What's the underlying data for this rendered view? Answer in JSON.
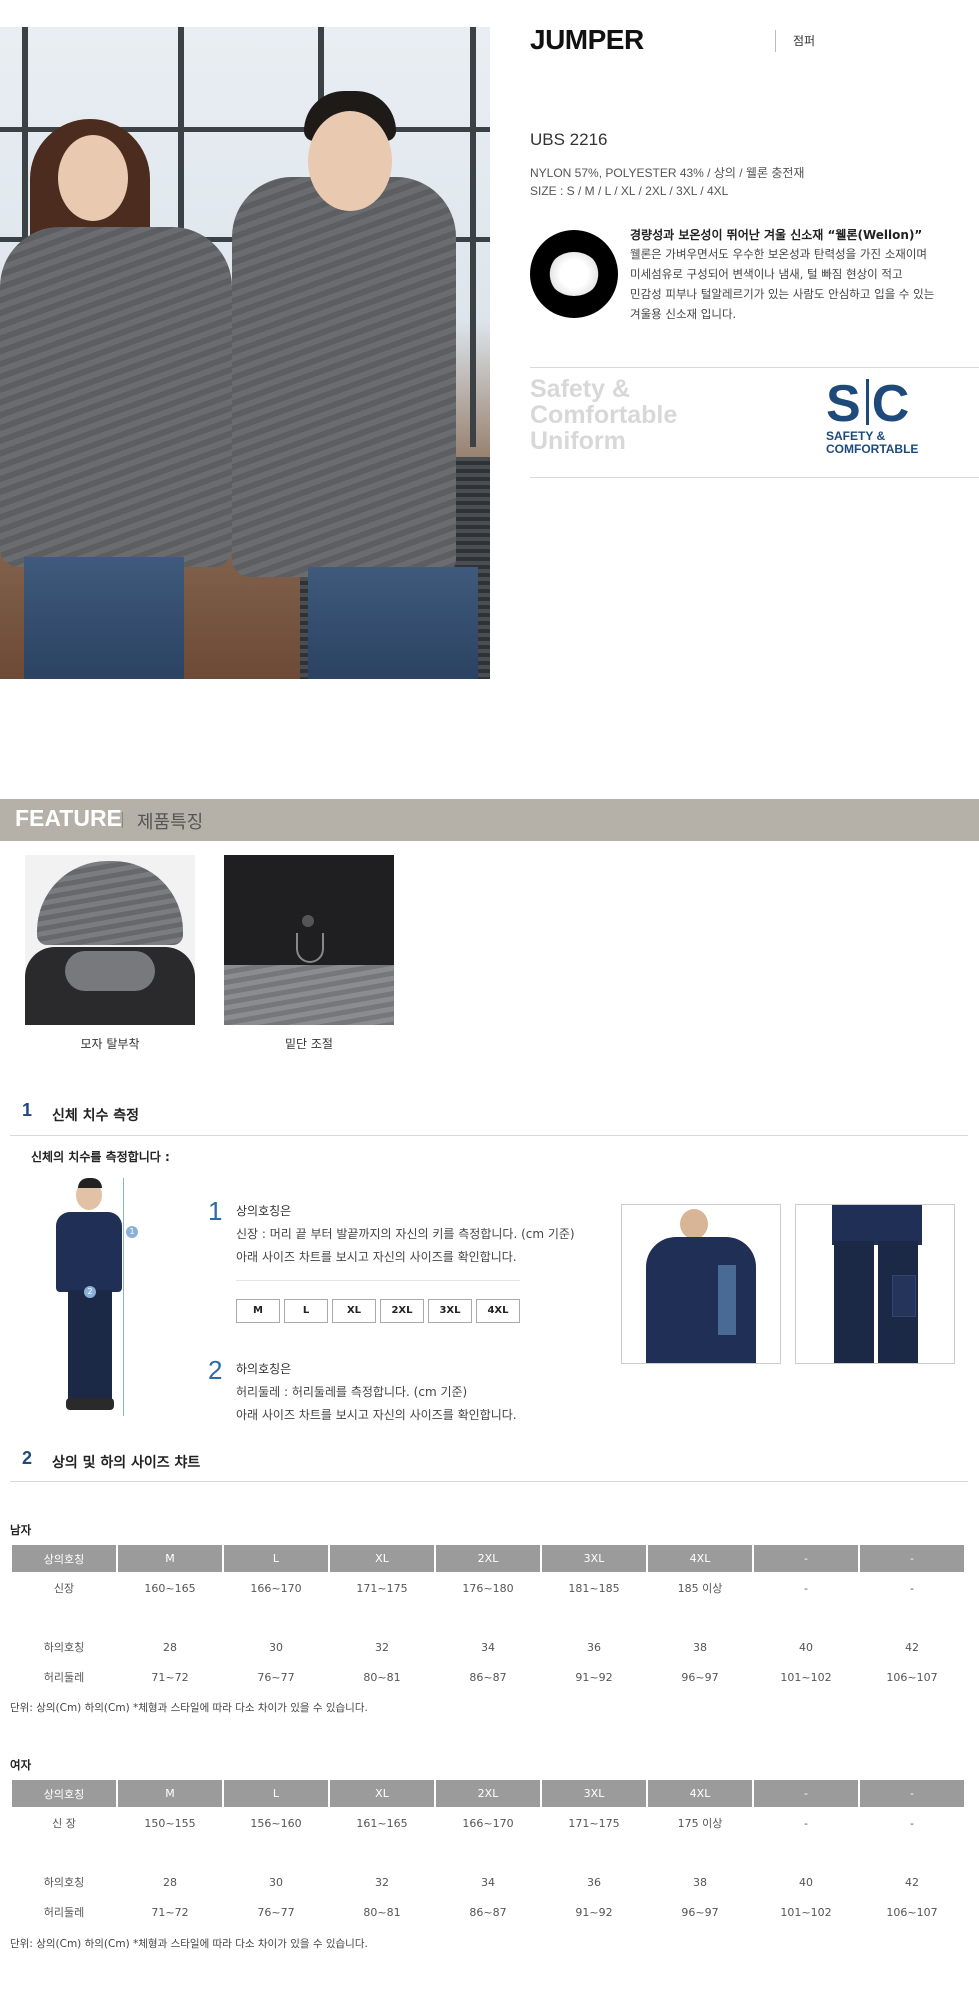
{
  "product": {
    "title": "JUMPER",
    "title_kr": "점퍼",
    "code": "UBS 2216",
    "material": "NYLON 57%, POLYESTER 43% / 상의 / 웰론 충전재",
    "sizes": "SIZE : S / M / L / XL / 2XL / 3XL / 4XL"
  },
  "wellon": {
    "headline": "경량성과 보온성이 뛰어난 겨울 신소재 “웰론(Wellon)”",
    "lines": [
      "웰론은 가벼우면서도 우수한 보온성과 탄력성을 가진 소재이며",
      "미세섬유로 구성되어 변색이나 냄새, 털 빠짐 현상이 적고",
      "민감성 피부나 털알레르기가 있는 사람도 안심하고 입을 수 있는",
      "겨울용 신소재 입니다."
    ]
  },
  "brand": {
    "slogan": [
      "Safety &",
      "Comfortable",
      "Uniform"
    ],
    "logo_left": "S",
    "logo_right": "C",
    "logo_sub": [
      "SAFETY &",
      "COMFORTABLE"
    ],
    "color": "#1d4a7a"
  },
  "feature": {
    "title_en": "FEATURE",
    "title_kr": "제품특징",
    "items": [
      {
        "caption": "모자 탈부착",
        "icon": "hood-photo"
      },
      {
        "caption": "밑단 조절",
        "icon": "hem-photo"
      }
    ]
  },
  "section1": {
    "number": "1",
    "title": "신체 치수 측정",
    "subtitle": "신체의 치수를 측정합니다 :",
    "top": {
      "number": "1",
      "title": "상의호칭은",
      "line1": "신장 : 머리 끝 부터 발끝까지의 자신의 키를 측정합니다. (cm 기준)",
      "line2": "아래 사이즈 차트를 보시고 자신의 사이즈를 확인합니다."
    },
    "size_buttons": [
      "M",
      "L",
      "XL",
      "2XL",
      "3XL",
      "4XL"
    ],
    "bottom": {
      "number": "2",
      "title": "하의호칭은",
      "line1": "허리둘레 : 허리둘레를 측정합니다. (cm 기준)",
      "line2": "아래 사이즈 차트를 보시고 자신의 사이즈를 확인합니다."
    }
  },
  "section2": {
    "number": "2",
    "title": "상의 및 하의 사이즈 챠트"
  },
  "men": {
    "label": "남자",
    "header": [
      "상의호칭",
      "M",
      "L",
      "XL",
      "2XL",
      "3XL",
      "4XL",
      "-",
      "-"
    ],
    "height_row": [
      "신장",
      "160~165",
      "166~170",
      "171~175",
      "176~180",
      "181~185",
      "185 이상",
      "-",
      "-"
    ],
    "bottom_row": [
      "하의호칭",
      "28",
      "30",
      "32",
      "34",
      "36",
      "38",
      "40",
      "42"
    ],
    "waist_row": [
      "허리둘레",
      "71~72",
      "76~77",
      "80~81",
      "86~87",
      "91~92",
      "96~97",
      "101~102",
      "106~107"
    ],
    "note": "단위: 상의(Cm) 하의(Cm) *체형과 스타일에 따라 다소 차이가 있을 수 있습니다."
  },
  "women": {
    "label": "여자",
    "header": [
      "상의호칭",
      "M",
      "L",
      "XL",
      "2XL",
      "3XL",
      "4XL",
      "-",
      "-"
    ],
    "height_row": [
      "신 장",
      "150~155",
      "156~160",
      "161~165",
      "166~170",
      "171~175",
      "175 이상",
      "-",
      "-"
    ],
    "bottom_row": [
      "하의호칭",
      "28",
      "30",
      "32",
      "34",
      "36",
      "38",
      "40",
      "42"
    ],
    "waist_row": [
      "허리둘레",
      "71~72",
      "76~77",
      "80~81",
      "86~87",
      "91~92",
      "96~97",
      "101~102",
      "106~107"
    ],
    "note": "단위: 상의(Cm) 하의(Cm) *체형과 스타일에 따라 다소 차이가 있을 수 있습니다."
  }
}
